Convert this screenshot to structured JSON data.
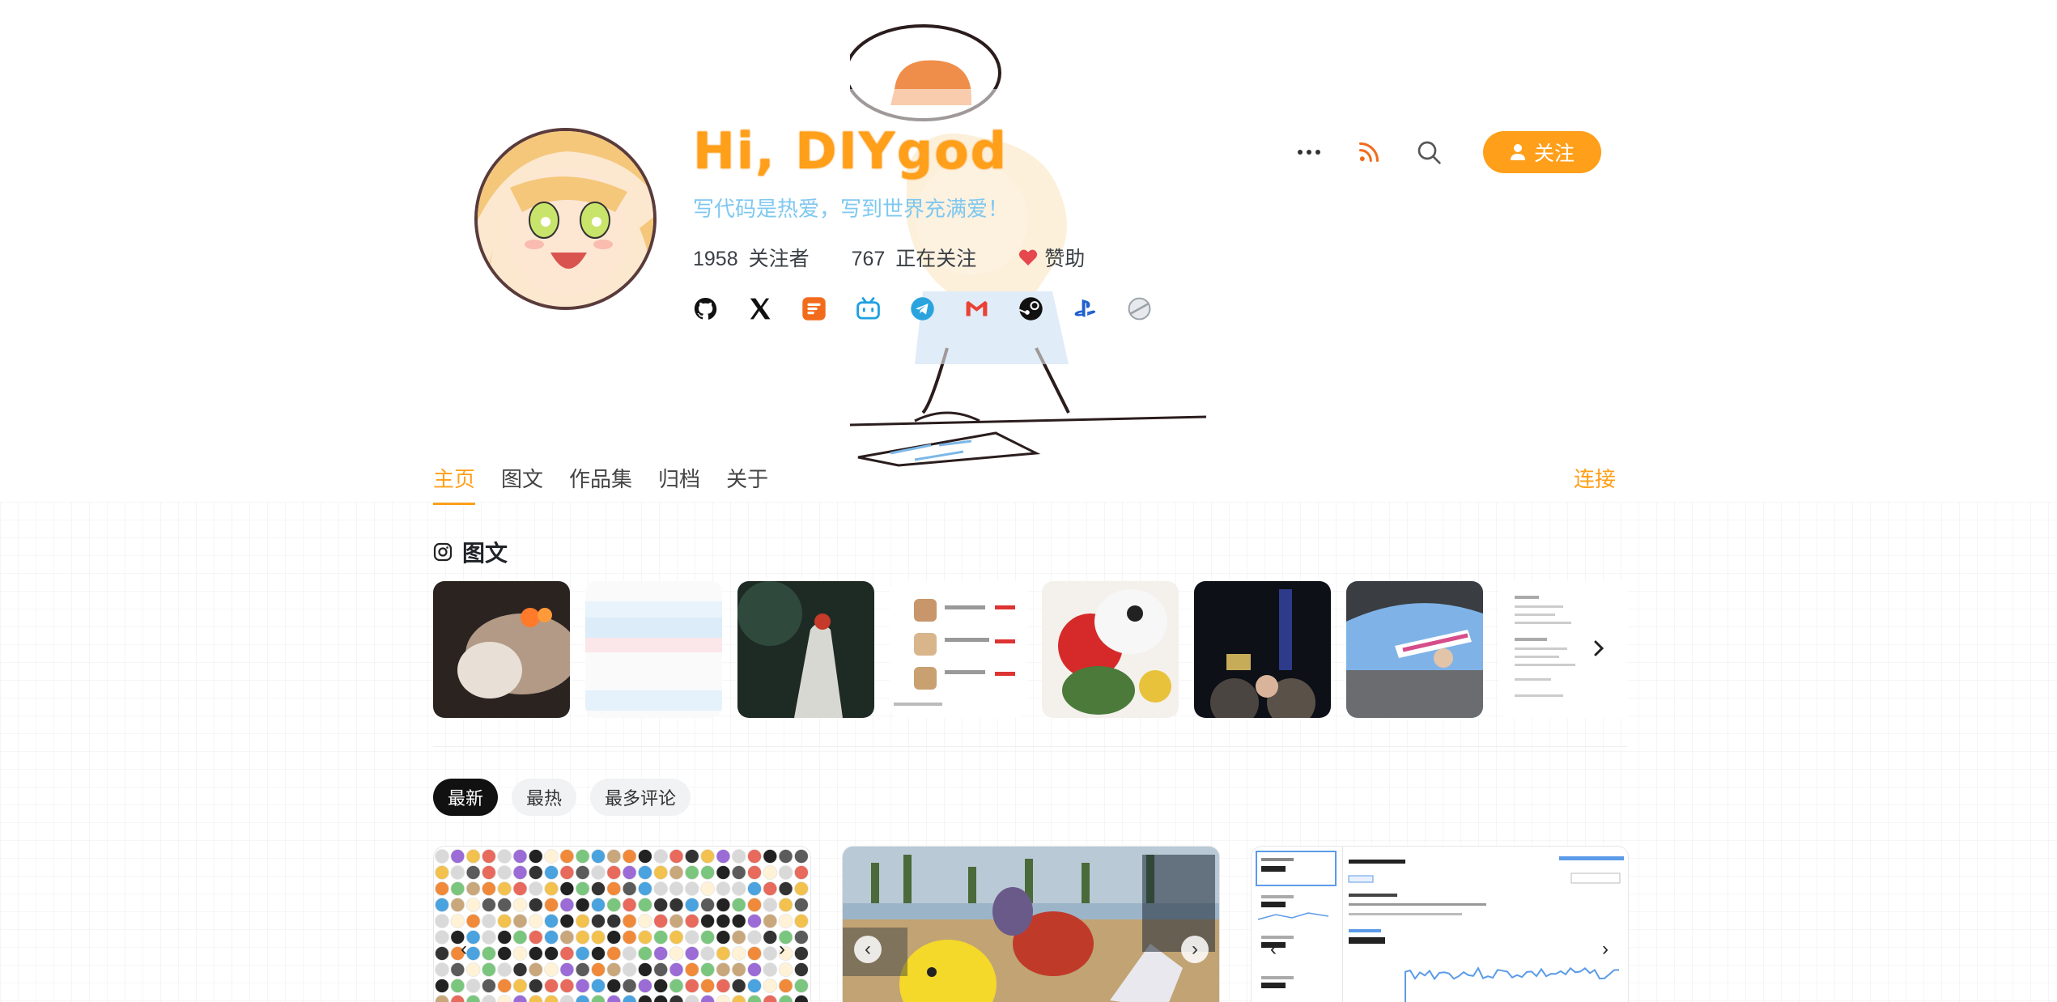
{
  "profile": {
    "title": "Hi, DIYgod",
    "subtitle": "写代码是热爱，写到世界充满爱！",
    "followers_count": "1958",
    "followers_label": "关注者",
    "following_count": "767",
    "following_label": "正在关注",
    "sponsor_label": "赞助"
  },
  "actions": {
    "follow_label": "关注",
    "more_icon": "more-icon",
    "rss_icon": "rss-icon",
    "search_icon": "search-icon"
  },
  "socials": [
    "github-icon",
    "x-icon",
    "xlog-icon",
    "bilibili-icon",
    "telegram-icon",
    "gmail-icon",
    "steam-icon",
    "playstation-icon",
    "planet-icon"
  ],
  "nav": {
    "tabs": [
      "主页",
      "图文",
      "作品集",
      "归档",
      "关于"
    ],
    "active_tab": "主页",
    "connect_label": "连接"
  },
  "gallery": {
    "title": "图文",
    "icon": "instagram-icon"
  },
  "filters": [
    "最新",
    "最热",
    "最多评论"
  ],
  "active_filter": "最新",
  "colors": {
    "accent": "#ff9f1a",
    "subtitle": "#7fc8f0",
    "heart": "#e5484d"
  }
}
